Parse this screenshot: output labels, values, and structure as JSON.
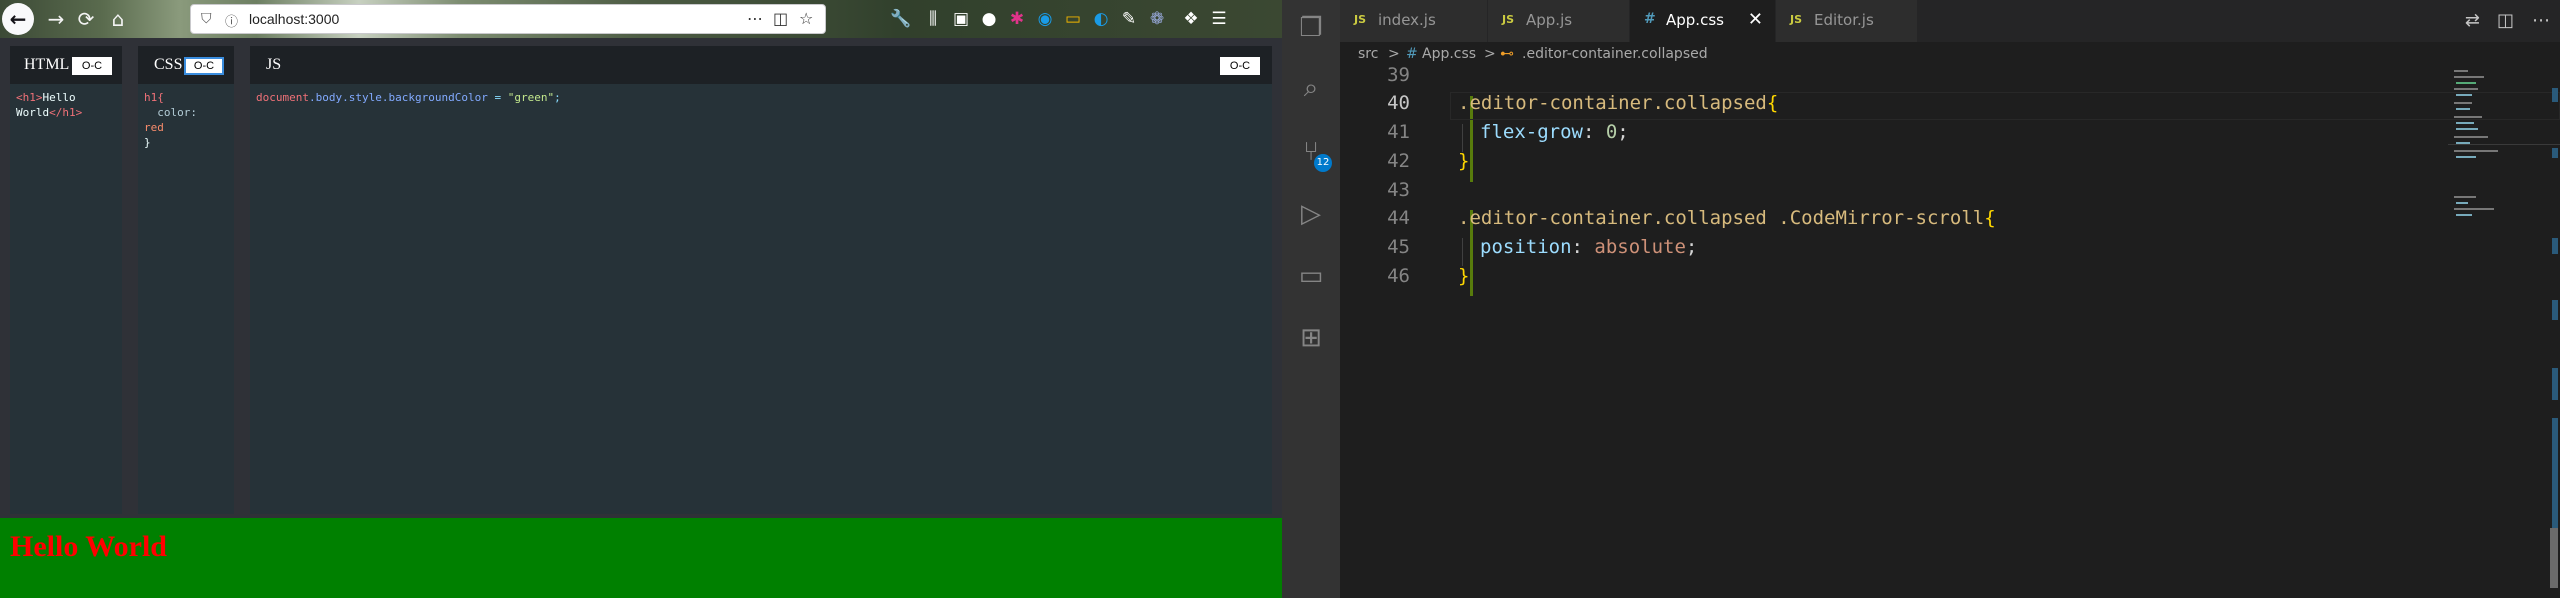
{
  "browser": {
    "url": "localhost:3000",
    "url_actions": [
      "...",
      "pocket-icon",
      "star-icon"
    ],
    "toolbar_icons": [
      "wrench-icon",
      "library-icon",
      "sidebar-icon",
      "extension-1",
      "extension-2",
      "extension-3",
      "extension-4",
      "extension-5",
      "extension-6",
      "extension-7",
      "extensions-icon",
      "menu-icon"
    ]
  },
  "panes": {
    "html": {
      "title": "HTML",
      "toggle": "O-C"
    },
    "css": {
      "title": "CSS",
      "toggle": "O-C"
    },
    "js": {
      "title": "JS",
      "toggle": "O-C"
    }
  },
  "html_code": {
    "open_tag": "<h1>",
    "text_1": "Hello",
    "text_2": "World",
    "close_tag": "</h1>"
  },
  "css_code": {
    "selector": "h1{",
    "prop": "color:",
    "val": "red",
    "close": "}"
  },
  "js_code": {
    "obj": "document",
    "p1": ".body",
    "p2": ".style",
    "p3": ".backgroundColor",
    "eq": " = ",
    "str": "\"green\"",
    "semi": ";"
  },
  "output": {
    "heading": "Hello World"
  },
  "vscode": {
    "badge": "12",
    "tabs": [
      {
        "icon": "JS",
        "label": "index.js",
        "active": false
      },
      {
        "icon": "JS",
        "label": "App.js",
        "active": false
      },
      {
        "icon": "#",
        "label": "App.css",
        "active": true
      },
      {
        "icon": "JS",
        "label": "Editor.js",
        "active": false
      }
    ],
    "close_glyph": "✕",
    "breadcrumb": {
      "root": "src",
      "sep": ">",
      "file": "App.css",
      "symbol": ".editor-container.collapsed"
    },
    "line_numbers": [
      "39",
      "40",
      "41",
      "42",
      "43",
      "44",
      "45",
      "46"
    ],
    "lines": {
      "l40_sel": ".editor-container.collapsed",
      "l40_brace": "{",
      "l41_prop": "flex-grow",
      "l41_colon": ": ",
      "l41_val": "0",
      "l41_semi": ";",
      "l42_brace": "}",
      "l44_sel": ".editor-container.collapsed .CodeMirror-scroll",
      "l44_brace": "{",
      "l45_prop": "position",
      "l45_colon": ": ",
      "l45_val": "absolute",
      "l45_semi": ";",
      "l46_brace": "}"
    }
  },
  "colors": {
    "output_bg": "#008000",
    "heading": "#ff0000",
    "vscode_bg": "#1e1e1e",
    "accent": "#007acc"
  }
}
